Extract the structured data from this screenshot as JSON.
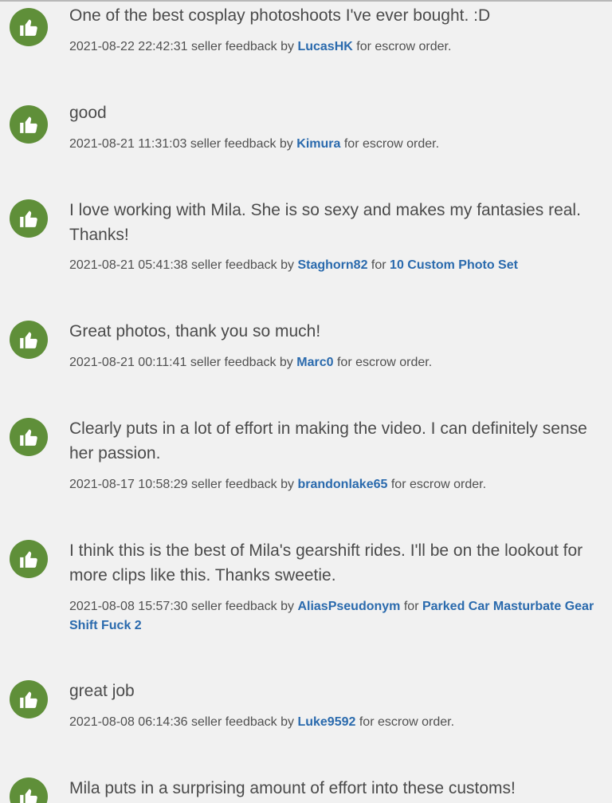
{
  "feedback": [
    {
      "comment": "One of the best cosplay photoshoots I've ever bought. :D",
      "timestamp": "2021-08-22 22:42:31",
      "type_text": "seller feedback by",
      "user": "LucasHK",
      "for_text": "for",
      "order": "escrow order.",
      "order_is_link": false
    },
    {
      "comment": "good",
      "timestamp": "2021-08-21 11:31:03",
      "type_text": "seller feedback by",
      "user": "Kimura",
      "for_text": "for",
      "order": "escrow order.",
      "order_is_link": false
    },
    {
      "comment": "I love working with Mila. She is so sexy and makes my fantasies real. Thanks!",
      "timestamp": "2021-08-21 05:41:38",
      "type_text": "seller feedback by",
      "user": "Staghorn82",
      "for_text": "for",
      "order": "10 Custom Photo Set",
      "order_is_link": true
    },
    {
      "comment": "Great photos, thank you so much!",
      "timestamp": "2021-08-21 00:11:41",
      "type_text": "seller feedback by",
      "user": "Marc0",
      "for_text": "for",
      "order": "escrow order.",
      "order_is_link": false
    },
    {
      "comment": "Clearly puts in a lot of effort in making the video. I can definitely sense her passion.",
      "timestamp": "2021-08-17 10:58:29",
      "type_text": "seller feedback by",
      "user": "brandonlake65",
      "for_text": "for",
      "order": "escrow order.",
      "order_is_link": false
    },
    {
      "comment": "I think this is the best of Mila's gearshift rides. I'll be on the lookout for more clips like this. Thanks sweetie.",
      "timestamp": "2021-08-08 15:57:30",
      "type_text": "seller feedback by",
      "user": "AliasPseudonym",
      "for_text": "for",
      "order": "Parked Car Masturbate Gear Shift Fuck 2",
      "order_is_link": true
    },
    {
      "comment": "great job",
      "timestamp": "2021-08-08 06:14:36",
      "type_text": "seller feedback by",
      "user": "Luke9592",
      "for_text": "for",
      "order": "escrow order.",
      "order_is_link": false
    },
    {
      "comment": "Mila puts in a surprising amount of effort into these customs!",
      "timestamp": "",
      "type_text": "",
      "user": "",
      "for_text": "",
      "order": "",
      "order_is_link": false
    }
  ],
  "icon": "thumbs-up-icon",
  "colors": {
    "background": "#f1f1f1",
    "positive_icon": "#5f8f39",
    "link": "#2a6aad",
    "text": "#4b4b4b"
  }
}
